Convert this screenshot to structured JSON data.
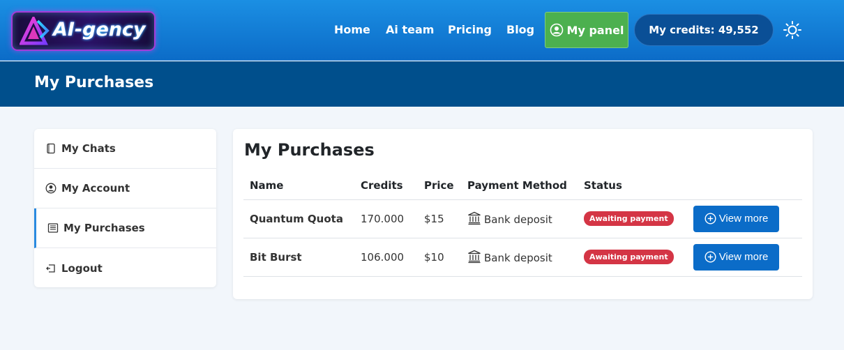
{
  "navbar": {
    "logo_text": "AI-gency",
    "links": [
      {
        "label": "Home"
      },
      {
        "label": "Ai team"
      },
      {
        "label": "Pricing"
      },
      {
        "label": "Blog"
      }
    ],
    "panel_button": "My panel",
    "credits_label": "My credits: 49,552",
    "theme_icon": "sun-icon"
  },
  "page_header": {
    "title": "My Purchases"
  },
  "sidebar": {
    "items": [
      {
        "label": "My Chats",
        "icon": "chat-icon"
      },
      {
        "label": "My Account",
        "icon": "user-icon"
      },
      {
        "label": "My Purchases",
        "icon": "receipt-icon",
        "active": true
      },
      {
        "label": "Logout",
        "icon": "logout-icon"
      }
    ]
  },
  "purchases": {
    "title": "My Purchases",
    "columns": [
      "Name",
      "Credits",
      "Price",
      "Payment Method",
      "Status",
      ""
    ],
    "rows": [
      {
        "name": "Quantum Quota",
        "credits": "170.000",
        "price": "$15",
        "payment_method": "Bank deposit",
        "status": "Awaiting payment",
        "action": "View more"
      },
      {
        "name": "Bit Burst",
        "credits": "106.000",
        "price": "$10",
        "payment_method": "Bank deposit",
        "status": "Awaiting payment",
        "action": "View more"
      }
    ]
  },
  "colors": {
    "navbar": "#1b8fe3",
    "page_band": "#004f8c",
    "panel_button": "#4cb04f",
    "credits_pill": "#0a4f96",
    "status_badge": "#d43545",
    "primary_button": "#0b6cc8"
  }
}
